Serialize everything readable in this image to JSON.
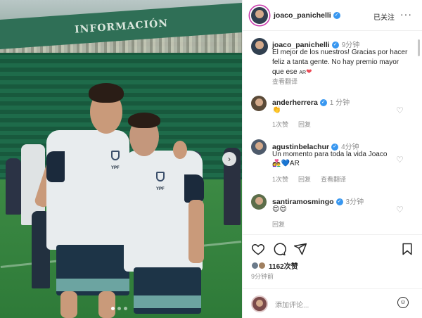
{
  "post": {
    "photo": {
      "banner_text": "INFORMACIÓN",
      "jersey_text_1": "YPF",
      "jersey_text_2": "YPF",
      "carousel_dots": 3,
      "active_dot": 1
    },
    "header": {
      "username": "joaco_panichelli",
      "follow_status": "已关注",
      "more_icon": "more-horizontal-icon"
    },
    "caption": {
      "username": "joaco_panichelli",
      "time": "9分钟",
      "text": "El mejor de los nuestros! Gracias por hacer feliz a tanta gente. No hay premio mayor que ese ",
      "suffix": "AR",
      "heart": "❤",
      "translate": "查看翻译"
    },
    "comments": [
      {
        "username": "anderherrera",
        "time": "1 分钟",
        "text": "👏",
        "likes": "1次赞",
        "reply": "回复"
      },
      {
        "username": "agustinbelachur",
        "time": "4分钟",
        "text": "Un momento para toda la vida Joaco 👩‍❤️‍👨💙AR",
        "likes": "1次赞",
        "reply": "回复",
        "translate": "查看翻译"
      },
      {
        "username": "santiramosmingo",
        "time": "3分钟",
        "text": "😍😍",
        "reply": "回复"
      }
    ],
    "footer": {
      "likes": "1162次赞",
      "time_ago": "9分钟前",
      "comment_placeholder": "添加评论..."
    },
    "colors": {
      "verified": "#3897f0",
      "heart": "#ed4956",
      "muted_text": "#8e8e8e"
    }
  }
}
